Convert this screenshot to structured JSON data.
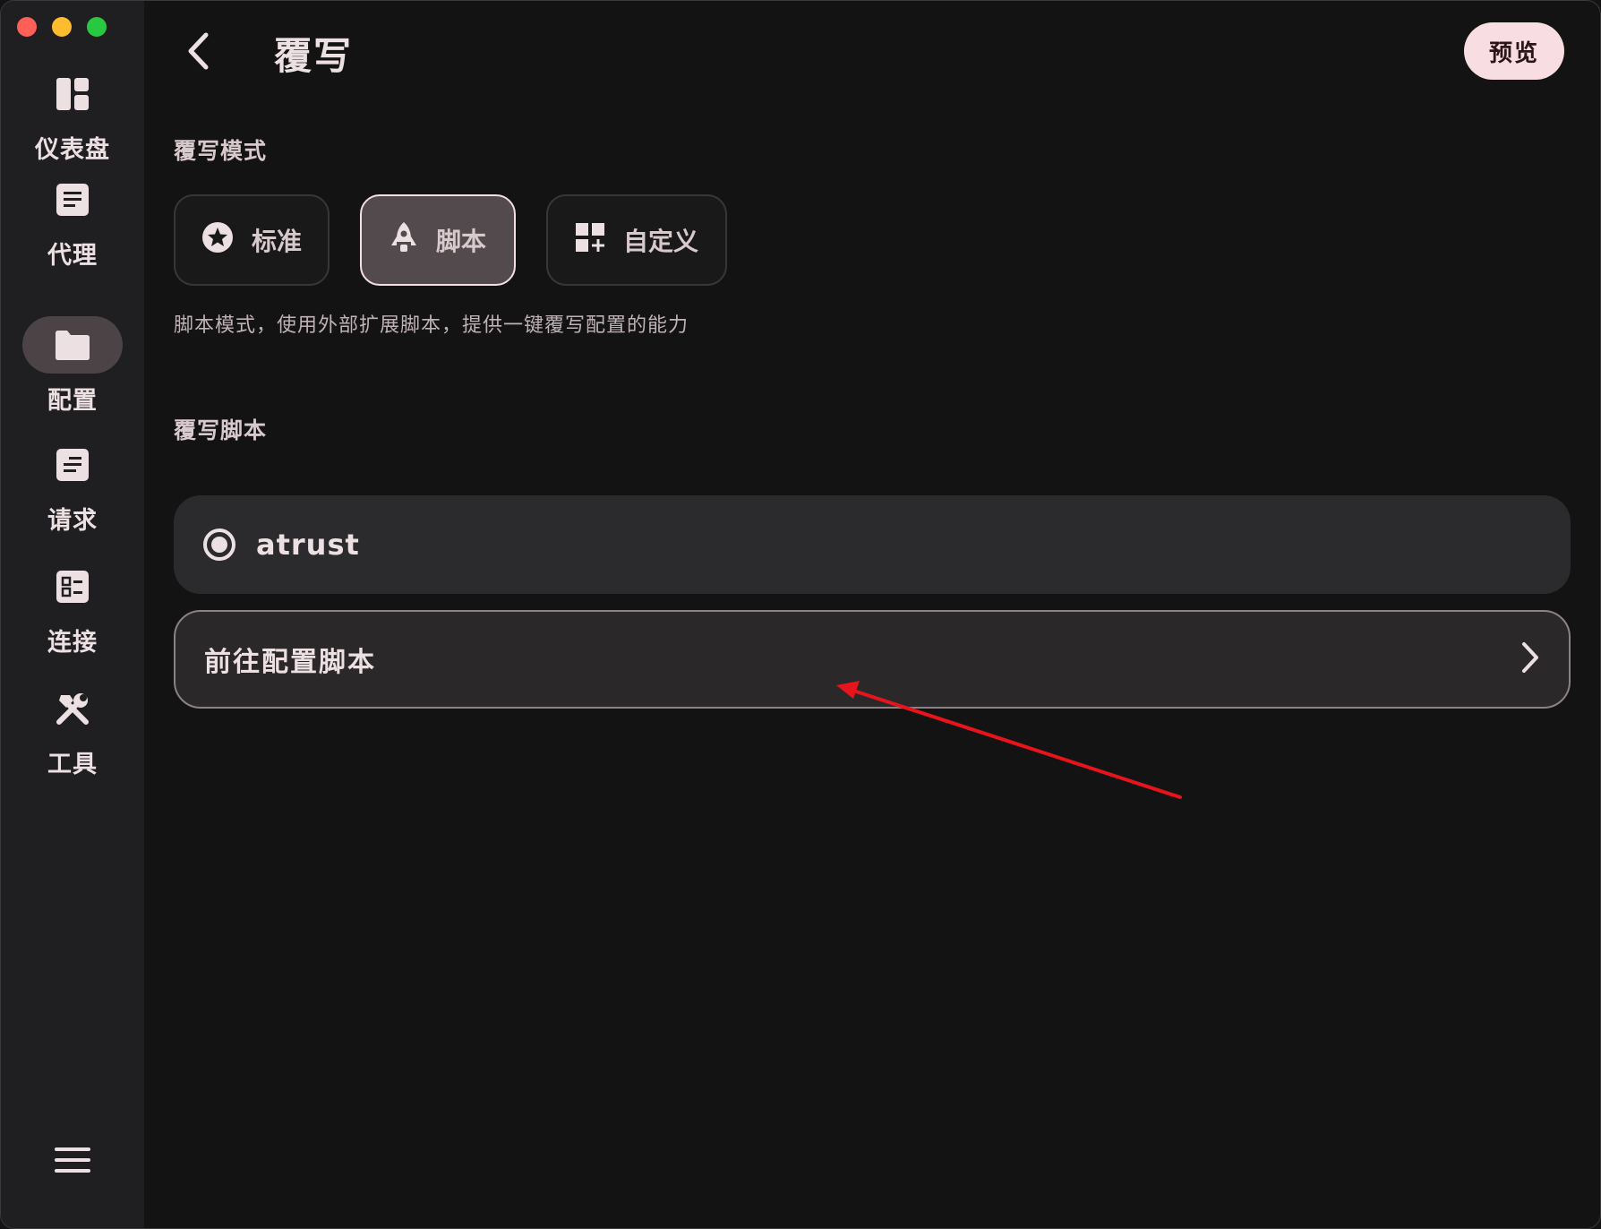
{
  "window": {
    "traffic_lights": [
      "close",
      "minimize",
      "zoom"
    ]
  },
  "sidebar": {
    "items": [
      {
        "label": "仪表盘",
        "icon": "dashboard-icon"
      },
      {
        "label": "代理",
        "icon": "document-icon"
      },
      {
        "label": "配置",
        "icon": "folder-icon",
        "active": true
      },
      {
        "label": "请求",
        "icon": "request-icon"
      },
      {
        "label": "连接",
        "icon": "connection-icon"
      },
      {
        "label": "工具",
        "icon": "tools-icon"
      }
    ],
    "menu_icon": "menu-icon"
  },
  "header": {
    "title": "覆写",
    "preview_label": "预览",
    "back_icon": "back-arrow-icon"
  },
  "modes": {
    "section_label": "覆写模式",
    "options": [
      {
        "label": "标准",
        "icon": "star-circle-icon"
      },
      {
        "label": "脚本",
        "icon": "rocket-icon",
        "selected": true
      },
      {
        "label": "自定义",
        "icon": "widgets-add-icon"
      }
    ],
    "description": "脚本模式，使用外部扩展脚本，提供一键覆写配置的能力"
  },
  "scripts": {
    "section_label": "覆写脚本",
    "items": [
      {
        "name": "atrust",
        "selected": true
      }
    ],
    "goto_label": "前往配置脚本"
  },
  "colors": {
    "background": "#141314",
    "sidebar": "#1f1e20",
    "accent_pink": "#f8dde2",
    "annotation_arrow": "#e8141c"
  }
}
